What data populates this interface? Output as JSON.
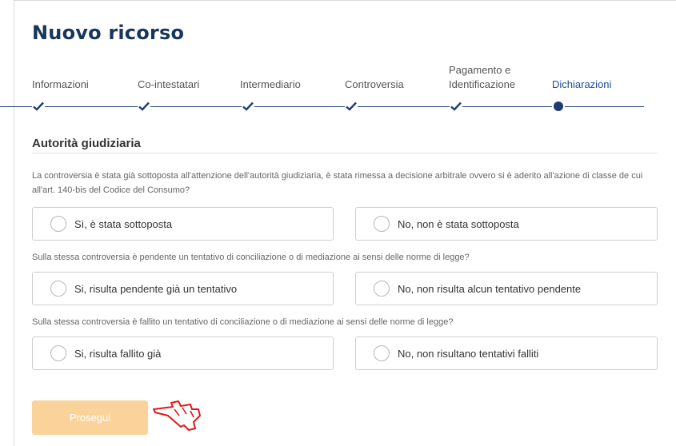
{
  "page": {
    "title": "Nuovo ricorso"
  },
  "stepper": {
    "steps": [
      {
        "line1": "",
        "line2": "Informazioni",
        "state": "done"
      },
      {
        "line1": "",
        "line2": "Co-intestatari",
        "state": "done"
      },
      {
        "line1": "",
        "line2": "Intermediario",
        "state": "done"
      },
      {
        "line1": "",
        "line2": "Controversia",
        "state": "done"
      },
      {
        "line1": "Pagamento e",
        "line2": "Identificazione",
        "state": "done"
      },
      {
        "line1": "",
        "line2": "Dichiarazioni",
        "state": "active"
      }
    ],
    "colors": {
      "line": "#1f3b73",
      "active_text": "#1f4e9c"
    }
  },
  "section": {
    "title": "Autorità giudiziaria"
  },
  "questions": [
    {
      "text": "La controversia è stata già sottoposta all'attenzione dell'autorità giudiziaria, è stata rimessa a decisione arbitrale ovvero si è aderito all'azione di classe de cui all'art. 140-bis del Codice del Consumo?",
      "options": [
        "Sì, è stata sottoposta",
        "No, non è stata sottoposta"
      ]
    },
    {
      "text": "Sulla stessa controversia è pendente un tentativo di conciliazione o di mediazione ai sensi delle norme di legge?",
      "options": [
        "Si, risulta pendente già un tentativo",
        "No, non risulta alcun tentativo pendente"
      ]
    },
    {
      "text": "Sulla stessa controversia è fallito un tentativo di conciliazione o di mediazione ai sensi delle norme di legge?",
      "options": [
        "Si, risulta fallito già",
        "No, non risultano tentativi falliti"
      ]
    }
  ],
  "actions": {
    "proceed_label": "Prosegui",
    "proceed_color": "#fad39b"
  },
  "icons": {
    "cursor": "hand-pointer-icon",
    "check": "check-icon",
    "current_step": "dot-icon"
  }
}
